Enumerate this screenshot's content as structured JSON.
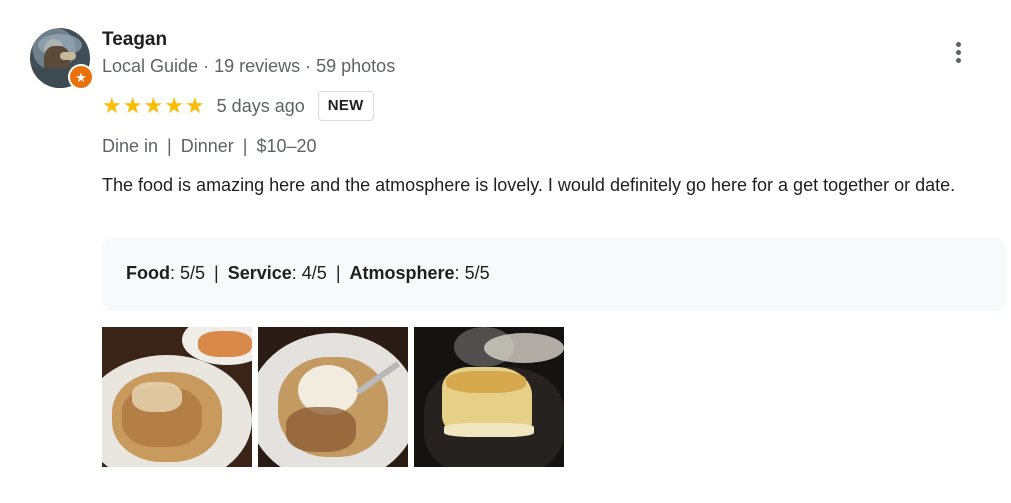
{
  "review": {
    "author": "Teagan",
    "author_badge": "Local Guide",
    "review_count": "19 reviews",
    "photo_count": "59 photos",
    "meta_separator": "·",
    "rating": 5,
    "rating_max": 5,
    "date": "5 days ago",
    "new_badge": "NEW",
    "attributes": [
      "Dine in",
      "Dinner",
      "$10–20"
    ],
    "attribute_separator": "|",
    "text": "The food is amazing here and the atmosphere is lovely. I would definitely go here for a get together or date.",
    "scores": [
      {
        "label": "Food",
        "value": "5/5"
      },
      {
        "label": "Service",
        "value": "4/5"
      },
      {
        "label": "Atmosphere",
        "value": "5/5"
      }
    ],
    "photos": [
      "pasta-photo",
      "pasta-photo",
      "dessert-photo"
    ]
  },
  "icons": {
    "star": "star-icon",
    "menu": "more-vert-icon",
    "guide": "local-guide-star-icon"
  },
  "colors": {
    "star": "#fbbc04",
    "guide_badge": "#e8710a",
    "secondary_text": "#5f6368",
    "score_panel": "#f8f9fa"
  }
}
